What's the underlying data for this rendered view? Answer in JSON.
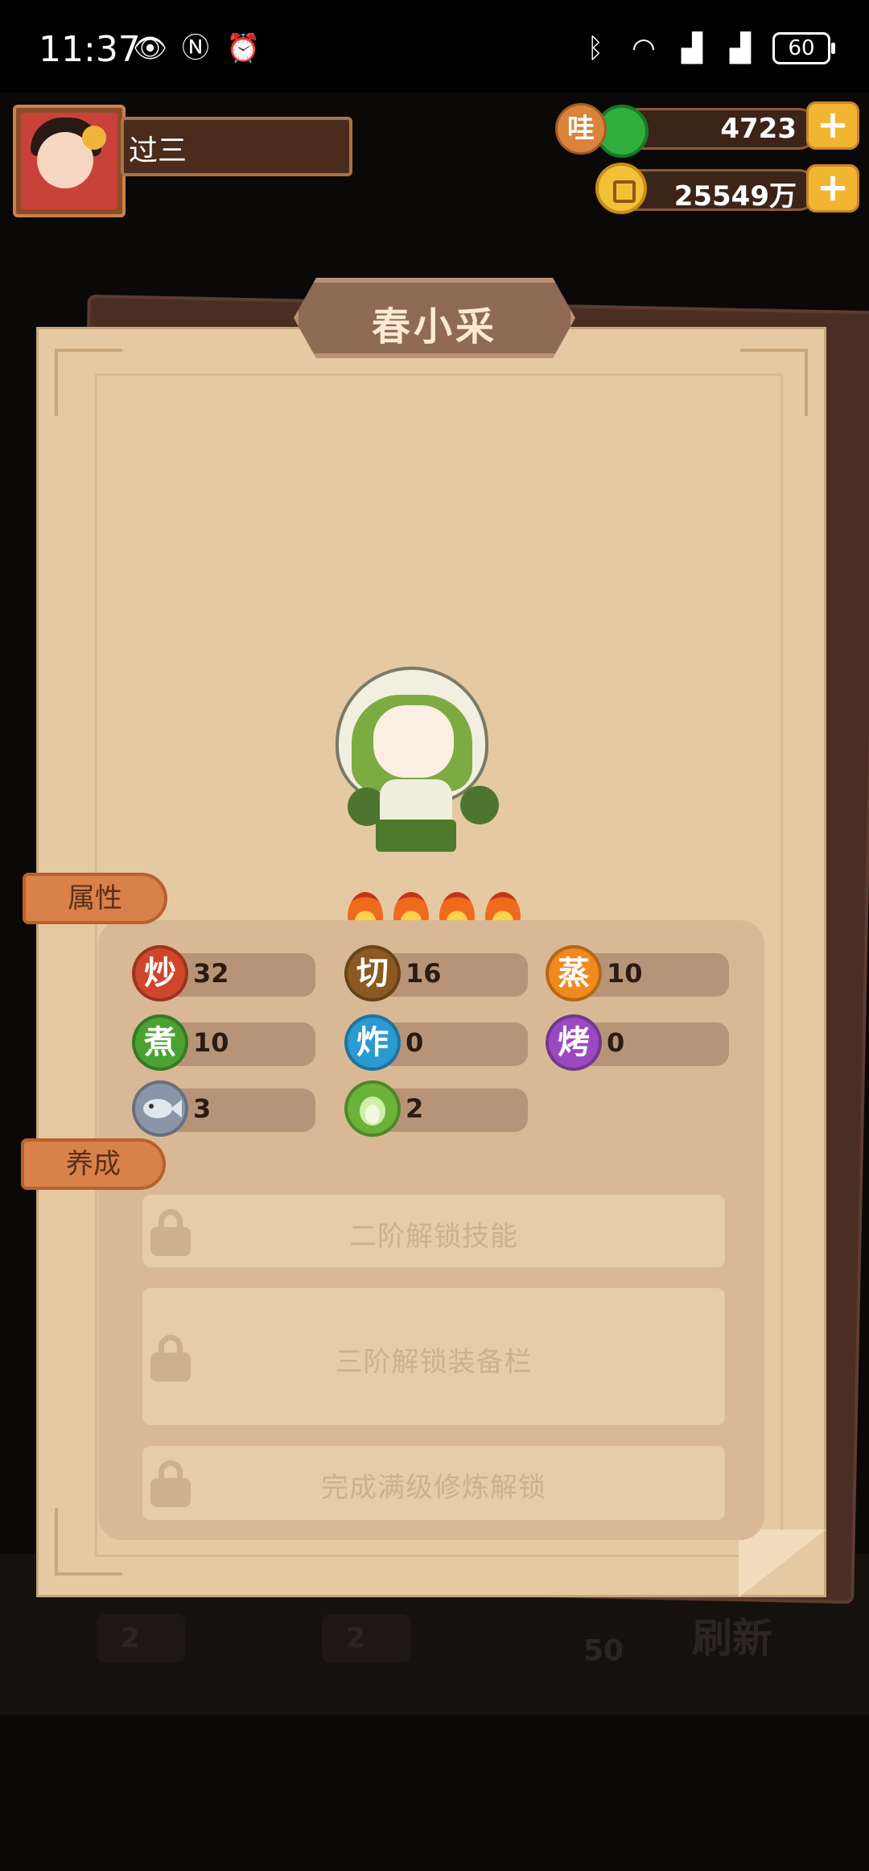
{
  "status_bar": {
    "time": "11:37",
    "battery": "60",
    "left_icons": [
      "eye-icon",
      "nfc-icon",
      "alarm-icon"
    ],
    "right_icons": [
      "bluetooth-icon",
      "wifi-icon",
      "signal-icon",
      "signal-icon",
      "battery-icon"
    ]
  },
  "player": {
    "name": "过三"
  },
  "currency": {
    "jade_badge": "哇",
    "jade_amount": "4723",
    "coin_amount": "25549万",
    "plus_symbol": "+"
  },
  "background": {
    "counts": [
      "2",
      "2",
      "50"
    ],
    "refresh_label": "刷新"
  },
  "character": {
    "name": "春小采",
    "flame_count": 4
  },
  "tabs": {
    "attributes": "属性",
    "cultivation": "养成"
  },
  "stats": [
    {
      "glyph": "炒",
      "value": "32",
      "color": "#d0462a"
    },
    {
      "glyph": "切",
      "value": "16",
      "color": "#8a5a22"
    },
    {
      "glyph": "蒸",
      "value": "10",
      "color": "#f08a1e"
    },
    {
      "glyph": "煮",
      "value": "10",
      "color": "#4aa232"
    },
    {
      "glyph": "炸",
      "value": "0",
      "color": "#2a9ad0"
    },
    {
      "glyph": "烤",
      "value": "0",
      "color": "#9a4ac0"
    },
    {
      "glyph": "fish-icon",
      "value": "3",
      "color": "#8a96a8"
    },
    {
      "glyph": "cabbage-icon",
      "value": "2",
      "color": "#6ab23a"
    }
  ],
  "locked": [
    "二阶解锁技能",
    "三阶解锁装备栏",
    "完成满级修炼解锁"
  ]
}
